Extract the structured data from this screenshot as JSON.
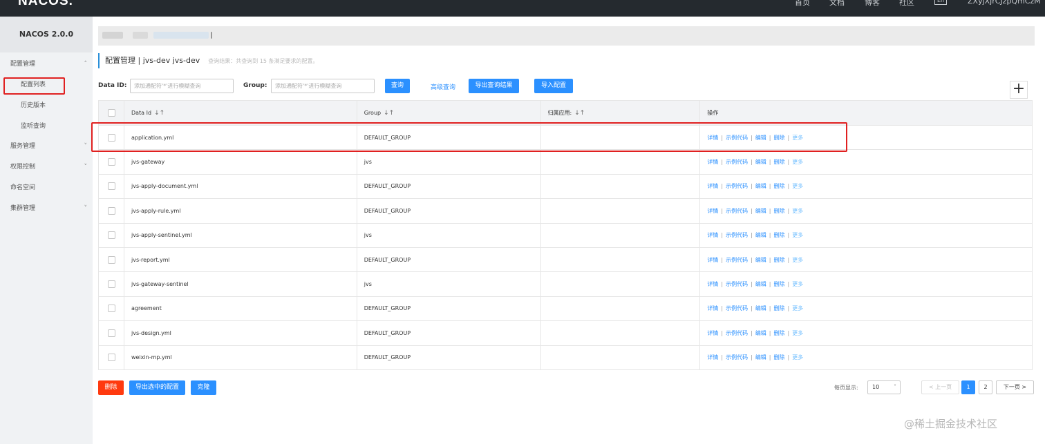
{
  "topbar": {
    "logo": "NACOS.",
    "nav": [
      "首页",
      "文档",
      "博客",
      "社区"
    ],
    "lang": "En",
    "user": "ZXyjXjrCJzpQmCzM"
  },
  "sidebar": {
    "brand": "NACOS 2.0.0",
    "items": [
      {
        "label": "配置管理",
        "chevron": "^"
      },
      {
        "label": "配置列表"
      },
      {
        "label": "历史版本"
      },
      {
        "label": "监听查询"
      },
      {
        "label": "服务管理",
        "chevron": "v"
      },
      {
        "label": "权限控制",
        "chevron": "v"
      },
      {
        "label": "命名空间"
      },
      {
        "label": "集群管理",
        "chevron": "v"
      }
    ]
  },
  "heading": {
    "title": "配置管理 | jvs-dev jvs-dev",
    "subtitle": "查询结果：共查询到 15 条满足要求的配置。"
  },
  "filters": {
    "data_id_label": "Data ID:",
    "data_id_placeholder": "添加通配符'*'进行模糊查询",
    "group_label": "Group:",
    "group_placeholder": "添加通配符'*'进行模糊查询",
    "search": "查询",
    "advanced": "高级查询",
    "export_results": "导出查询结果",
    "import": "导入配置",
    "add": "+"
  },
  "table": {
    "headers": [
      "Data Id",
      "Group",
      "归属应用:",
      "操作"
    ],
    "sort_icon": "↓↑",
    "ops": [
      "详情",
      "示例代码",
      "编辑",
      "删除",
      "更多"
    ],
    "rows": [
      {
        "data_id": "application.yml",
        "group": "DEFAULT_GROUP",
        "app": ""
      },
      {
        "data_id": "jvs-gateway",
        "group": "jvs",
        "app": ""
      },
      {
        "data_id": "jvs-apply-document.yml",
        "group": "DEFAULT_GROUP",
        "app": ""
      },
      {
        "data_id": "jvs-apply-rule.yml",
        "group": "DEFAULT_GROUP",
        "app": ""
      },
      {
        "data_id": "jvs-apply-sentinel.yml",
        "group": "jvs",
        "app": ""
      },
      {
        "data_id": "jvs-report.yml",
        "group": "DEFAULT_GROUP",
        "app": ""
      },
      {
        "data_id": "jvs-gateway-sentinel",
        "group": "jvs",
        "app": ""
      },
      {
        "data_id": "agreement",
        "group": "DEFAULT_GROUP",
        "app": ""
      },
      {
        "data_id": "jvs-design.yml",
        "group": "DEFAULT_GROUP",
        "app": ""
      },
      {
        "data_id": "weixin-mp.yml",
        "group": "DEFAULT_GROUP",
        "app": ""
      }
    ]
  },
  "bottom": {
    "delete": "删除",
    "export_selected": "导出选中的配置",
    "clone": "克隆",
    "page_size_label": "每页显示:",
    "page_size": "10",
    "prev": "< 上一页",
    "pages": [
      "1",
      "2"
    ],
    "current_page": "1",
    "next": "下一页 >"
  },
  "watermark": "@稀土掘金技术社区",
  "colors": {
    "primary": "#2b90ff",
    "danger": "#ff3a0f",
    "topbar": "#252a2f",
    "highlight": "#e02020"
  }
}
